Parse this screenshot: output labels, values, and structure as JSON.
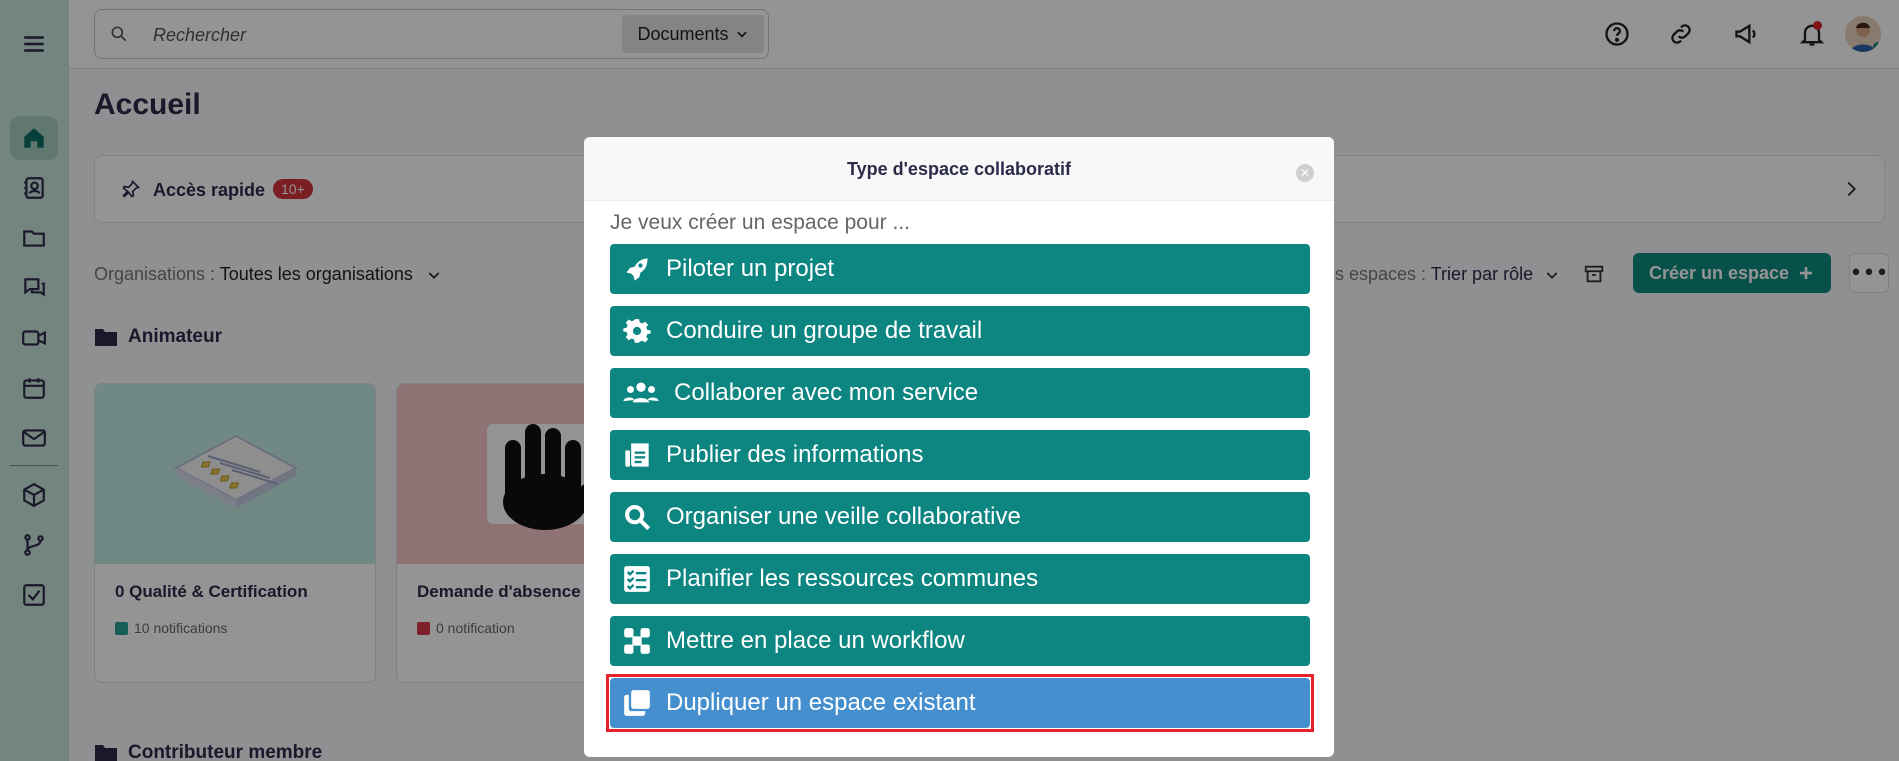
{
  "search": {
    "placeholder": "Rechercher",
    "scope": "Documents"
  },
  "page": {
    "title": "Accueil"
  },
  "quick_access": {
    "label": "Accès rapide",
    "badge": "10+"
  },
  "filters": {
    "org_key": "Organisations :",
    "org_value": "Toutes les organisations",
    "sort_key": "s espaces :",
    "sort_value": "Trier par rôle"
  },
  "create_button": "Créer un espace",
  "sections": {
    "first": "Animateur",
    "second": "Contributeur membre"
  },
  "cards": [
    {
      "name": "0 Qualité & Certification",
      "notifications": "10 notifications",
      "color": "#2aa197"
    },
    {
      "name": "Demande d'absence",
      "notifications": "0 notification",
      "color": "#d63a48"
    }
  ],
  "modal": {
    "title": "Type d'espace collaboratif",
    "prompt": "Je veux créer un espace pour ...",
    "options": [
      {
        "label": "Piloter un projet",
        "icon": "rocket-icon"
      },
      {
        "label": "Conduire un groupe de travail",
        "icon": "gear-icon"
      },
      {
        "label": "Collaborer avec mon service",
        "icon": "users-icon"
      },
      {
        "label": "Publier des informations",
        "icon": "newspaper-icon"
      },
      {
        "label": "Organiser une veille collaborative",
        "icon": "search-icon"
      },
      {
        "label": "Planifier les ressources communes",
        "icon": "checklist-icon"
      },
      {
        "label": "Mettre en place un workflow",
        "icon": "workflow-icon"
      },
      {
        "label": "Dupliquer un espace existant",
        "icon": "copy-icon"
      }
    ]
  },
  "colors": {
    "accent": "#0d8580",
    "selected": "#468fcf",
    "highlight": "#e3222a"
  }
}
